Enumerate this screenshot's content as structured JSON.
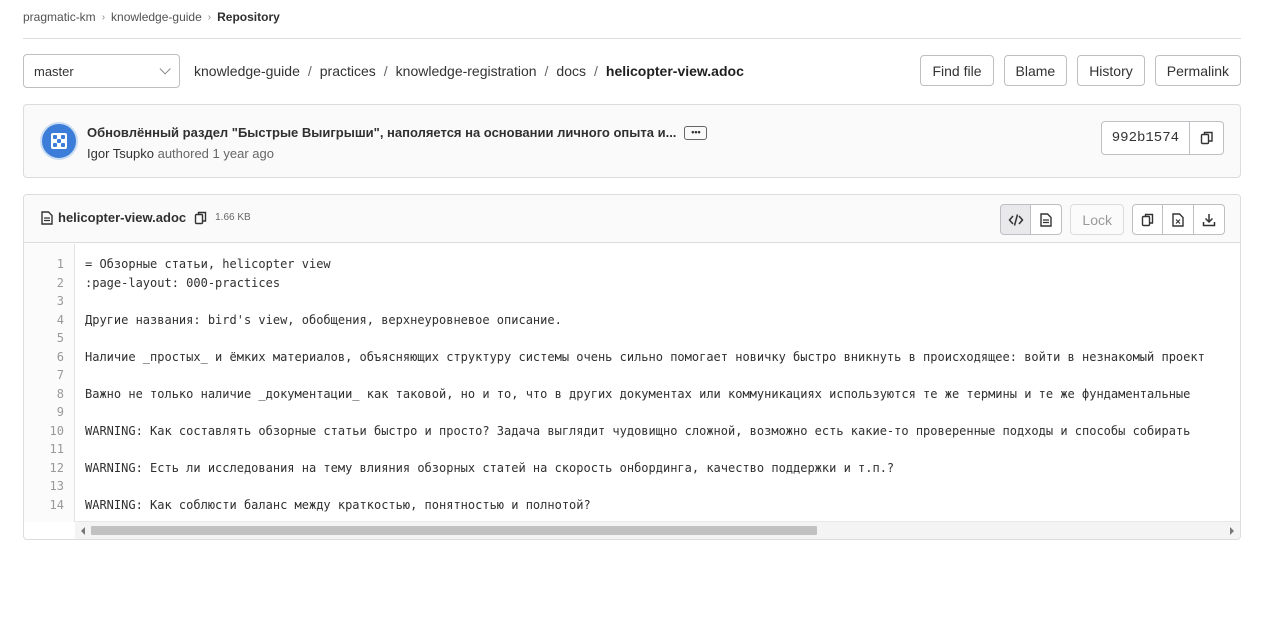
{
  "breadcrumb": {
    "items": [
      "pragmatic-km",
      "knowledge-guide"
    ],
    "current": "Repository"
  },
  "branch": {
    "selected": "master"
  },
  "path": {
    "segments": [
      "knowledge-guide",
      "practices",
      "knowledge-registration",
      "docs"
    ],
    "file": "helicopter-view.adoc"
  },
  "toolbar": {
    "find_file": "Find file",
    "blame": "Blame",
    "history": "History",
    "permalink": "Permalink"
  },
  "commit": {
    "message": "Обновлённый раздел \"Быстрые Выигрыши\", наполяется на основании личного опыта и...",
    "ellipsis": "•••",
    "author": "Igor Tsupko",
    "authored_text": "authored 1 year ago",
    "sha": "992b1574",
    "avatar_color": "#3b7dd8"
  },
  "file": {
    "name": "helicopter-view.adoc",
    "size": "1.66 KB",
    "lock_label": "Lock",
    "icons": [
      "code-icon",
      "document-icon",
      "copy-icon",
      "raw-file-icon",
      "download-icon"
    ]
  },
  "code": {
    "lines": [
      "= Обзорные статьи, helicopter view",
      ":page-layout: 000-practices",
      "",
      "Другие названия: bird's view, обобщения, верхнеуровневое описание.",
      "",
      "Наличие _простых_ и ёмких материалов, объясняющих структуру системы очень сильно помогает новичку быстро вникнуть в происходящее: войти в незнакомый проект",
      "",
      "Важно не только наличие _документации_ как таковой, но и то, что в других документах или коммуникациях используются те же термины и те же фундаментальные",
      "",
      "WARNING: Как составлять обзорные статьи быстро и просто? Задача выглядит чудовищно сложной, возможно есть какие-то проверенные подходы и способы собирать",
      "",
      "WARNING: Есть ли исследования на тему влияния обзорных статей на скорость онбординга, качество поддержки и т.п.?",
      "",
      "WARNING: Как соблюсти баланс между краткостью, понятностью и полнотой?"
    ]
  }
}
